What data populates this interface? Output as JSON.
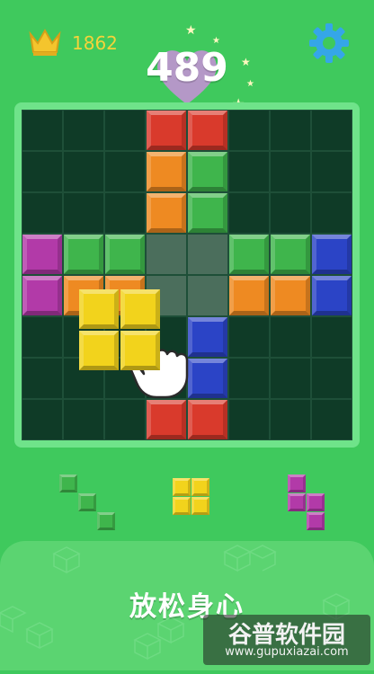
{
  "hud": {
    "best_score": "1862",
    "current_score": "489",
    "crown_icon": "crown-icon",
    "heart_icon": "heart-icon",
    "settings_icon": "gear-icon"
  },
  "board": {
    "size": 8,
    "placed_blocks": [
      {
        "row": 0,
        "col": 3,
        "color": "red"
      },
      {
        "row": 0,
        "col": 4,
        "color": "red"
      },
      {
        "row": 1,
        "col": 3,
        "color": "orange"
      },
      {
        "row": 1,
        "col": 4,
        "color": "green"
      },
      {
        "row": 2,
        "col": 3,
        "color": "orange"
      },
      {
        "row": 2,
        "col": 4,
        "color": "green"
      },
      {
        "row": 3,
        "col": 0,
        "color": "purple"
      },
      {
        "row": 3,
        "col": 1,
        "color": "green"
      },
      {
        "row": 3,
        "col": 2,
        "color": "green"
      },
      {
        "row": 3,
        "col": 5,
        "color": "green"
      },
      {
        "row": 3,
        "col": 6,
        "color": "green"
      },
      {
        "row": 3,
        "col": 7,
        "color": "blue"
      },
      {
        "row": 4,
        "col": 0,
        "color": "purple"
      },
      {
        "row": 4,
        "col": 1,
        "color": "orange"
      },
      {
        "row": 4,
        "col": 2,
        "color": "orange"
      },
      {
        "row": 4,
        "col": 5,
        "color": "orange"
      },
      {
        "row": 4,
        "col": 6,
        "color": "orange"
      },
      {
        "row": 4,
        "col": 7,
        "color": "blue"
      },
      {
        "row": 5,
        "col": 4,
        "color": "blue"
      },
      {
        "row": 6,
        "col": 4,
        "color": "blue"
      },
      {
        "row": 7,
        "col": 3,
        "color": "red"
      },
      {
        "row": 7,
        "col": 4,
        "color": "red"
      }
    ],
    "highlight_cells": [
      {
        "row": 3,
        "col": 3
      },
      {
        "row": 3,
        "col": 4
      },
      {
        "row": 4,
        "col": 3
      },
      {
        "row": 4,
        "col": 4
      }
    ],
    "dragging_piece": {
      "color": "yellow",
      "cells": [
        {
          "row": 0,
          "col": 0
        },
        {
          "row": 0,
          "col": 1
        },
        {
          "row": 1,
          "col": 0
        },
        {
          "row": 1,
          "col": 1
        }
      ]
    }
  },
  "tray": {
    "pieces": [
      {
        "name": "green-diagonal-piece",
        "color": "green",
        "cells": [
          {
            "r": 0,
            "c": 0
          },
          {
            "r": 1,
            "c": 1
          },
          {
            "r": 2,
            "c": 2
          }
        ]
      },
      {
        "name": "yellow-square-piece",
        "color": "yellow",
        "cells": [
          {
            "r": 0,
            "c": 0
          },
          {
            "r": 0,
            "c": 1
          },
          {
            "r": 1,
            "c": 0
          },
          {
            "r": 1,
            "c": 1
          }
        ]
      },
      {
        "name": "purple-s-piece",
        "color": "purple",
        "cells": [
          {
            "r": 0,
            "c": 0
          },
          {
            "r": 1,
            "c": 0
          },
          {
            "r": 1,
            "c": 1
          },
          {
            "r": 2,
            "c": 1
          }
        ]
      }
    ]
  },
  "footer": {
    "slogan": "放松身心"
  },
  "watermark": {
    "title": "谷普软件园",
    "url": "www.gupuxiazai.com"
  },
  "colors": {
    "background": "#3fc95d",
    "board": "#0f3b27",
    "red": "#d93a2c",
    "orange": "#ee8a22",
    "green": "#3fb54c",
    "purple": "#b23aa8",
    "blue": "#2b44c6",
    "yellow": "#f2d31c"
  }
}
